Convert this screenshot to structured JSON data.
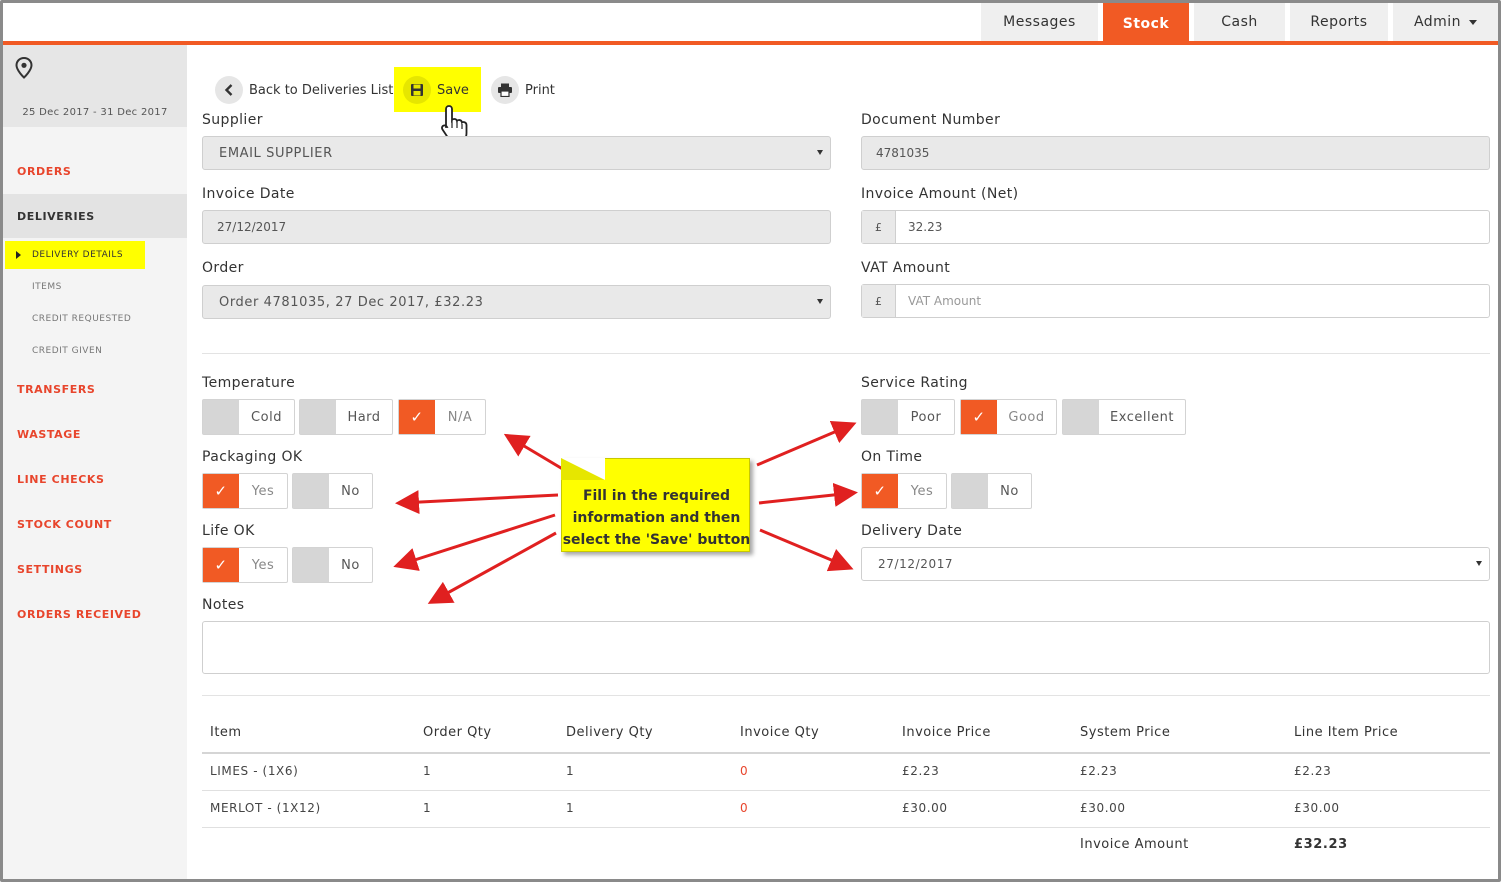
{
  "topnav": {
    "tabs": [
      {
        "label": "Messages",
        "active": false
      },
      {
        "label": "Stock",
        "active": true
      },
      {
        "label": "Cash",
        "active": false
      },
      {
        "label": "Reports",
        "active": false
      },
      {
        "label": "Admin",
        "active": false
      }
    ]
  },
  "sidebar": {
    "date_range": "25 Dec 2017 - 31 Dec 2017",
    "items": [
      "ORDERS",
      "DELIVERIES",
      "TRANSFERS",
      "WASTAGE",
      "LINE CHECKS",
      "STOCK COUNT",
      "SETTINGS",
      "ORDERS RECEIVED"
    ],
    "deliveries_sub": [
      "DELIVERY DETAILS",
      "ITEMS",
      "CREDIT REQUESTED",
      "CREDIT GIVEN"
    ]
  },
  "toolbar": {
    "back_label": "Back to Deliveries List",
    "save_label": "Save",
    "print_label": "Print"
  },
  "form": {
    "supplier_label": "Supplier",
    "supplier_value": "EMAIL SUPPLIER",
    "doc_number_label": "Document Number",
    "doc_number_value": "4781035",
    "invoice_date_label": "Invoice Date",
    "invoice_date_value": "27/12/2017",
    "invoice_amount_label": "Invoice Amount (Net)",
    "currency_symbol": "£",
    "invoice_amount_value": "32.23",
    "order_label": "Order",
    "order_value": "Order 4781035, 27 Dec 2017, £32.23",
    "vat_label": "VAT Amount",
    "vat_placeholder": "VAT Amount",
    "temperature_label": "Temperature",
    "temperature_options": [
      "Cold",
      "Hard",
      "N/A"
    ],
    "service_label": "Service Rating",
    "service_options": [
      "Poor",
      "Good",
      "Excellent"
    ],
    "packaging_label": "Packaging OK",
    "packaging_options": [
      "Yes",
      "No"
    ],
    "ontime_label": "On Time",
    "ontime_options": [
      "Yes",
      "No"
    ],
    "life_label": "Life OK",
    "life_options": [
      "Yes",
      "No"
    ],
    "delivery_date_label": "Delivery Date",
    "delivery_date_value": "27/12/2017",
    "notes_label": "Notes",
    "check_glyph": "✓"
  },
  "table": {
    "headers": [
      "Item",
      "Order Qty",
      "Delivery Qty",
      "Invoice Qty",
      "Invoice Price",
      "System Price",
      "Line Item Price"
    ],
    "rows": [
      [
        "LIMES - (1X6)",
        "1",
        "1",
        "0",
        "£2.23",
        "£2.23",
        "£2.23"
      ],
      [
        "MERLOT - (1X12)",
        "1",
        "1",
        "0",
        "£30.00",
        "£30.00",
        "£30.00"
      ]
    ],
    "total_label": "Invoice Amount",
    "total_value": "£32.23"
  },
  "callout": {
    "line1": "Fill in the required",
    "line2": "information and then",
    "line3": "select the 'Save' button"
  },
  "colors": {
    "accent": "#f15a24",
    "highlight": "#ffff00",
    "arrow": "#e02020"
  }
}
